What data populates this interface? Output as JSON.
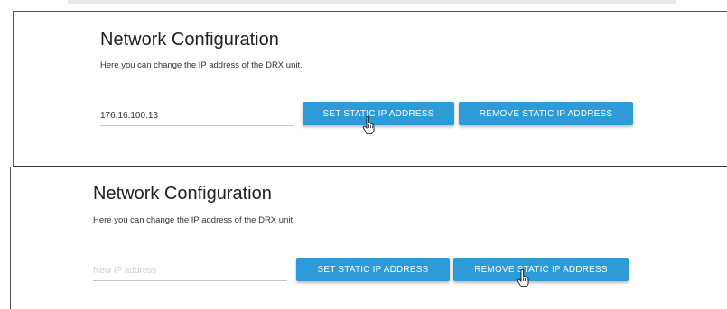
{
  "panels": [
    {
      "title": "Network Configuration",
      "description": "Here you can change the IP address of the DRX unit.",
      "ip_value": "176.16.100.13",
      "ip_placeholder": "",
      "set_button": "SET STATIC IP ADDRESS",
      "remove_button": "REMOVE STATIC IP ADDRESS",
      "hovered_button": "set"
    },
    {
      "title": "Network Configuration",
      "description": "Here you can change the IP address of the DRX unit.",
      "ip_value": "",
      "ip_placeholder": "New IP address",
      "set_button": "SET STATIC IP ADDRESS",
      "remove_button": "REMOVE STATIC IP ADDRESS",
      "hovered_button": "remove"
    }
  ],
  "colors": {
    "button_bg": "#2c9bd8",
    "button_text": "#ffffff"
  },
  "icons": {
    "pointer": "hand-pointer-icon"
  }
}
